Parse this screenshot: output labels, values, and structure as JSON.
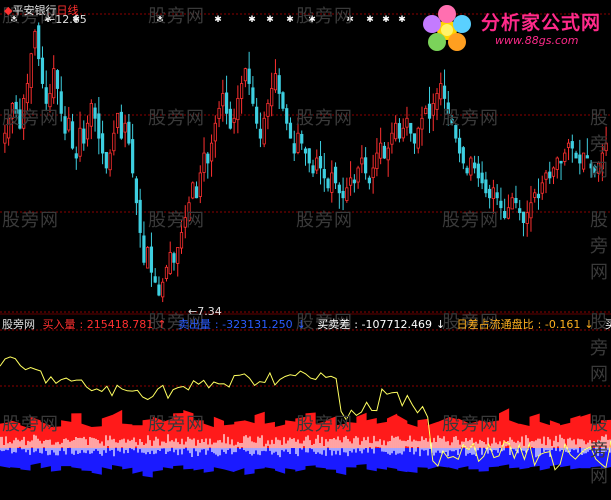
{
  "header": {
    "stock_name": "平安银行",
    "period": "日线",
    "high_price_label": "12.65",
    "low_price_label": "7.34"
  },
  "logo": {
    "title": "分析家公式网",
    "url": "www.88gs.com"
  },
  "watermark_text": "股旁网",
  "indicator": {
    "title": "股旁网",
    "items": [
      {
        "label": "买入量",
        "value": "215418.781",
        "arrow": "↑",
        "color": "#ff3030"
      },
      {
        "label": "卖出量",
        "value": "-323131.250",
        "arrow": "↓",
        "color": "#2a5cff"
      },
      {
        "label": "买卖差",
        "value": "-107712.469",
        "arrow": "↓",
        "color": "#ffffff"
      },
      {
        "label": "日差占流通盘比",
        "value": "-0.161",
        "arrow": "↓",
        "color": "#ffb020"
      },
      {
        "label": "买卖",
        "value": "",
        "arrow": "",
        "color": "#ffffff"
      }
    ]
  },
  "colors": {
    "up": "#ff3030",
    "down": "#3ecfe0",
    "buy": "#ff1a1a",
    "sell": "#1a1aff",
    "diff": "#ffffff",
    "ratio": "#ffff60",
    "gridline": "#8b0000"
  },
  "chart_data": [
    {
      "type": "candlestick",
      "title": "平安银行 日线",
      "ylim": [
        7.0,
        13.0
      ],
      "max_label": 12.65,
      "min_label": 7.34,
      "closes": [
        10.6,
        10.9,
        11.2,
        11.0,
        10.7,
        11.3,
        11.6,
        12.2,
        12.65,
        12.1,
        11.6,
        11.2,
        11.4,
        11.9,
        11.5,
        11.0,
        10.6,
        10.9,
        10.3,
        10.1,
        10.7,
        10.4,
        10.8,
        11.2,
        10.9,
        10.5,
        10.2,
        9.9,
        10.2,
        10.6,
        11.0,
        10.5,
        10.8,
        10.4,
        9.8,
        9.2,
        8.6,
        8.0,
        8.3,
        7.8,
        7.6,
        7.34,
        7.6,
        7.9,
        8.2,
        8.0,
        8.3,
        8.6,
        8.9,
        9.2,
        9.6,
        9.3,
        9.8,
        10.2,
        10.0,
        10.4,
        10.8,
        11.1,
        11.4,
        11.0,
        10.7,
        10.9,
        11.3,
        11.6,
        11.9,
        11.6,
        11.2,
        10.8,
        10.5,
        10.9,
        11.2,
        11.5,
        11.8,
        11.4,
        11.1,
        10.8,
        10.5,
        10.2,
        10.6,
        10.4,
        10.2,
        10.0,
        9.8,
        10.1,
        9.9,
        9.7,
        9.5,
        9.8,
        9.6,
        9.4,
        9.3,
        9.5,
        9.7,
        9.6,
        9.9,
        10.1,
        9.8,
        9.6,
        9.9,
        10.2,
        10.4,
        10.1,
        10.3,
        10.6,
        10.8,
        10.5,
        10.7,
        10.9,
        10.6,
        10.4,
        10.7,
        10.9,
        11.1,
        10.9,
        11.2,
        11.4,
        11.6,
        11.3,
        11.0,
        10.8,
        10.5,
        10.2,
        10.0,
        9.8,
        10.1,
        9.9,
        9.7,
        9.6,
        9.4,
        9.3,
        9.5,
        9.3,
        9.1,
        8.9,
        9.1,
        9.3,
        9.2,
        9.0,
        8.8,
        9.0,
        9.2,
        9.4,
        9.3,
        9.6,
        9.8,
        9.7,
        9.9,
        10.1,
        10.0,
        10.2,
        10.4,
        10.3,
        10.1,
        10.0,
        10.2,
        10.1,
        9.9,
        9.8,
        10.0,
        10.2,
        10.4
      ]
    },
    {
      "type": "area",
      "title": "股旁网",
      "series": [
        {
          "name": "买入量",
          "values": [
            0.6,
            0.7,
            0.55,
            0.8,
            0.65,
            0.5,
            0.7,
            0.9,
            0.6,
            0.5,
            0.75,
            0.85,
            0.6,
            0.55,
            0.7,
            0.8,
            0.65,
            0.9,
            1.0,
            0.7,
            0.6,
            0.8,
            0.55,
            0.65,
            0.7,
            0.85,
            0.6,
            0.5,
            0.7,
            0.75,
            0.9,
            0.6,
            0.7,
            0.55,
            0.65,
            0.8,
            0.7,
            0.6,
            0.75,
            0.85,
            0.6,
            0.7,
            0.55,
            0.65,
            0.8,
            0.75,
            0.6,
            0.7,
            0.65,
            0.9,
            0.7,
            0.6,
            0.8,
            0.65,
            0.7,
            0.55,
            0.75,
            0.8,
            0.6,
            0.7
          ]
        },
        {
          "name": "卖出量",
          "values": [
            -0.55,
            -0.6,
            -0.7,
            -0.5,
            -0.65,
            -0.8,
            -0.55,
            -0.6,
            -0.75,
            -0.85,
            -0.6,
            -0.5,
            -0.7,
            -0.9,
            -1.0,
            -0.8,
            -0.6,
            -0.55,
            -0.7,
            -0.75,
            -0.85,
            -0.6,
            -0.7,
            -0.8,
            -0.95,
            -0.7,
            -0.6,
            -0.75,
            -0.65,
            -0.8,
            -0.55,
            -0.6,
            -0.7,
            -0.85,
            -0.6,
            -0.5,
            -0.7,
            -0.65,
            -0.6,
            -0.75,
            -0.8,
            -0.6,
            -0.7,
            -0.55,
            -0.6,
            -0.65,
            -0.7,
            -0.8,
            -0.6,
            -0.55,
            -0.65,
            -0.7,
            -0.6,
            -0.75,
            -0.55,
            -0.6,
            -0.7,
            -0.65,
            -0.6,
            -0.7
          ]
        }
      ]
    }
  ]
}
